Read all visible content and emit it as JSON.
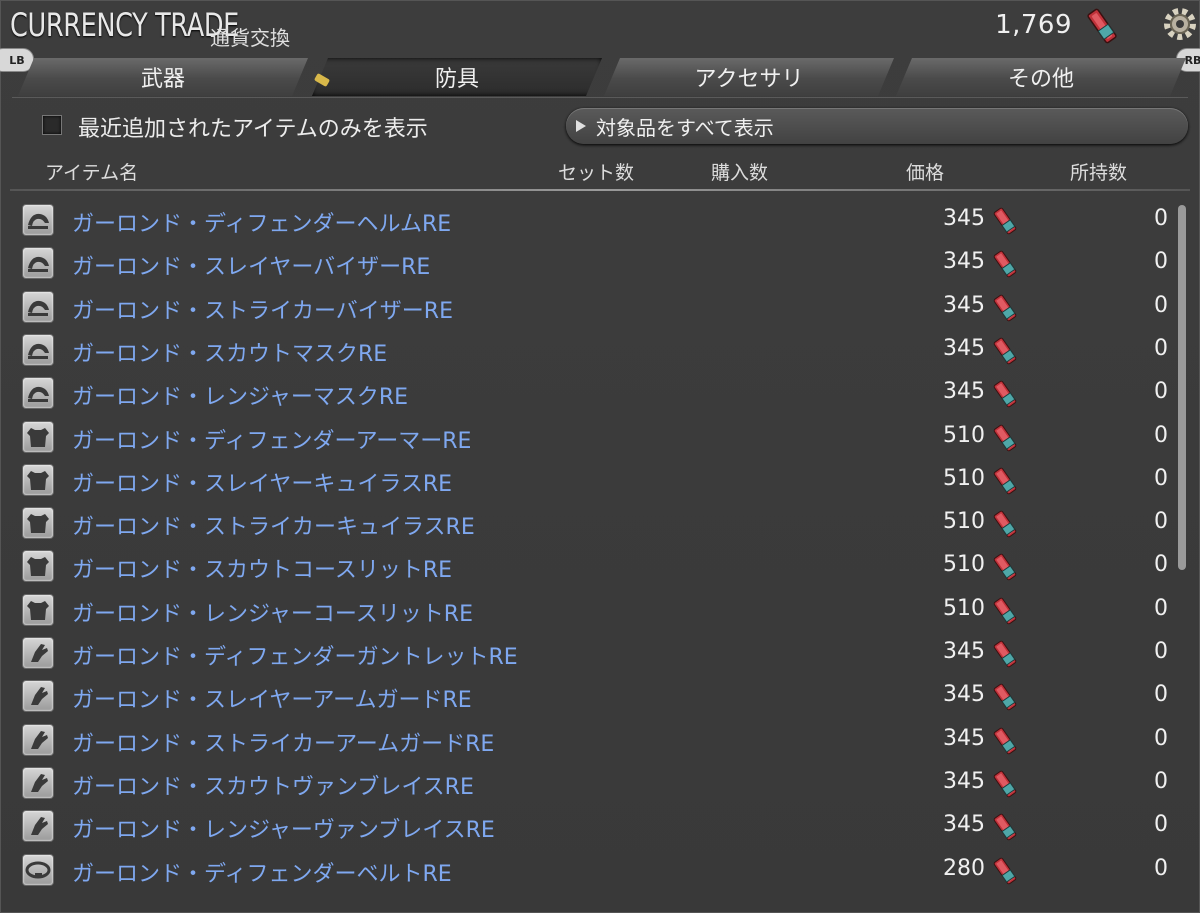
{
  "header": {
    "title_en": "CURRENCY TRADE",
    "title_jp": "通貨交換",
    "currency_amount": "1,769",
    "lb": "LB",
    "rb": "RB"
  },
  "tabs": [
    {
      "label": "武器",
      "active": false
    },
    {
      "label": "防具",
      "active": true
    },
    {
      "label": "アクセサリ",
      "active": false
    },
    {
      "label": "その他",
      "active": false
    }
  ],
  "filter": {
    "checkbox_label": "最近追加されたアイテムのみを表示",
    "checked": false,
    "show_all_label": "対象品をすべて表示"
  },
  "columns": {
    "name": "アイテム名",
    "set": "セット数",
    "buy": "購入数",
    "price": "価格",
    "owned": "所持数"
  },
  "items": [
    {
      "icon": "helm-icon",
      "name": "ガーロンド・ディフェンダーヘルムRE",
      "price": "345",
      "owned": "0"
    },
    {
      "icon": "helm-icon",
      "name": "ガーロンド・スレイヤーバイザーRE",
      "price": "345",
      "owned": "0"
    },
    {
      "icon": "helm-icon",
      "name": "ガーロンド・ストライカーバイザーRE",
      "price": "345",
      "owned": "0"
    },
    {
      "icon": "helm-icon",
      "name": "ガーロンド・スカウトマスクRE",
      "price": "345",
      "owned": "0"
    },
    {
      "icon": "helm-icon",
      "name": "ガーロンド・レンジャーマスクRE",
      "price": "345",
      "owned": "0"
    },
    {
      "icon": "body-armor-icon",
      "name": "ガーロンド・ディフェンダーアーマーRE",
      "price": "510",
      "owned": "0"
    },
    {
      "icon": "body-armor-icon",
      "name": "ガーロンド・スレイヤーキュイラスRE",
      "price": "510",
      "owned": "0"
    },
    {
      "icon": "body-armor-icon",
      "name": "ガーロンド・ストライカーキュイラスRE",
      "price": "510",
      "owned": "0"
    },
    {
      "icon": "body-armor-icon",
      "name": "ガーロンド・スカウトコースリットRE",
      "price": "510",
      "owned": "0"
    },
    {
      "icon": "body-armor-icon",
      "name": "ガーロンド・レンジャーコースリットRE",
      "price": "510",
      "owned": "0"
    },
    {
      "icon": "gauntlet-icon",
      "name": "ガーロンド・ディフェンダーガントレットRE",
      "price": "345",
      "owned": "0"
    },
    {
      "icon": "gauntlet-icon",
      "name": "ガーロンド・スレイヤーアームガードRE",
      "price": "345",
      "owned": "0"
    },
    {
      "icon": "gauntlet-icon",
      "name": "ガーロンド・ストライカーアームガードRE",
      "price": "345",
      "owned": "0"
    },
    {
      "icon": "gauntlet-icon",
      "name": "ガーロンド・スカウトヴァンブレイスRE",
      "price": "345",
      "owned": "0"
    },
    {
      "icon": "gauntlet-icon",
      "name": "ガーロンド・レンジャーヴァンブレイスRE",
      "price": "345",
      "owned": "0"
    },
    {
      "icon": "belt-icon",
      "name": "ガーロンド・ディフェンダーベルトRE",
      "price": "280",
      "owned": "0"
    }
  ],
  "colors": {
    "item_name": "#7fa8f0",
    "currency_red": "#c0323a",
    "currency_teal": "#4fa7a8"
  }
}
